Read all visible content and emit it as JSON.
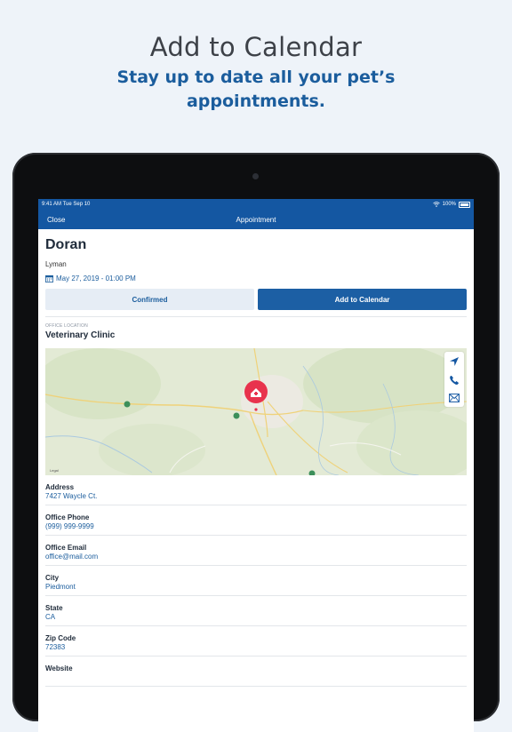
{
  "promo": {
    "title": "Add to Calendar",
    "subtitle_line1": "Stay up to date all your pet’s",
    "subtitle_line2": "appointments."
  },
  "status_bar": {
    "time": "9:41 AM  Tue Sep 10",
    "battery": "100%"
  },
  "nav": {
    "close_label": "Close",
    "title": "Appointment"
  },
  "appointment": {
    "pet_name": "Doran",
    "owner": "Lyman",
    "datetime": "May 27, 2019 - 01:00 PM",
    "confirmed_label": "Confirmed",
    "add_calendar_label": "Add to Calendar"
  },
  "office": {
    "section_label": "OFFICE LOCATION",
    "name": "Veterinary Clinic",
    "map_legal": "Legal"
  },
  "fields": [
    {
      "label": "Address",
      "value": "7427 Waycle Ct."
    },
    {
      "label": "Office Phone",
      "value": "(999) 999-9999"
    },
    {
      "label": "Office Email",
      "value": "office@mail.com"
    },
    {
      "label": "City",
      "value": "Piedmont"
    },
    {
      "label": "State",
      "value": "CA"
    },
    {
      "label": "Zip Code",
      "value": "72383"
    },
    {
      "label": "Website",
      "value": ""
    }
  ],
  "icons": {
    "map_pin": "vet-clinic-pin-icon",
    "directions": "navigation-arrow-icon",
    "phone": "phone-icon",
    "email": "envelope-icon",
    "calendar": "calendar-icon"
  },
  "colors": {
    "brand_blue": "#1457a2",
    "link_blue": "#1b5d9d",
    "pin_red": "#e8334d",
    "background": "#eef3f9"
  }
}
